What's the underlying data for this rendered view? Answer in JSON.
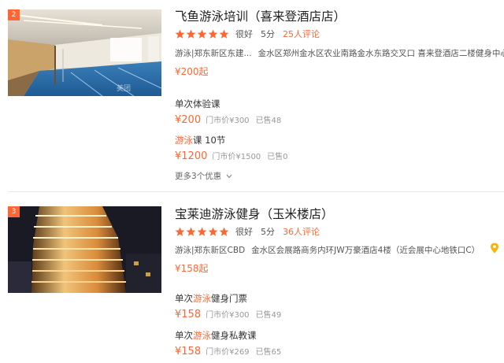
{
  "listings": [
    {
      "rank": "2",
      "title": "飞鱼游泳培训（喜来登酒店店）",
      "rating_word": "很好",
      "score": "5分",
      "reviews": "25人评论",
      "category": "游泳|郑东新区东建...",
      "address": "金水区郑州金水区农业南路金水东路交叉口 喜来登酒店二楼健身中心",
      "from_price": "¥200起",
      "watermark": "美团",
      "deals": [
        {
          "name_pre": "单次体验课",
          "name_hl": "",
          "name_post": "",
          "price": "¥200",
          "orig": "门市价¥300",
          "sold": "已售48"
        },
        {
          "name_pre": "",
          "name_hl": "游泳",
          "name_post": "课 10节",
          "price": "¥1200",
          "orig": "门市价¥1500",
          "sold": "已售0"
        }
      ],
      "more": "更多3个优惠"
    },
    {
      "rank": "3",
      "title": "宝莱迪游泳健身（玉米楼店）",
      "rating_word": "很好",
      "score": "5分",
      "reviews": "36人评论",
      "category": "游泳|郑东新区CBD",
      "address": "金水区会展路商务内环JW万豪酒店4楼（近会展中心地铁口C）",
      "from_price": "¥158起",
      "deals": [
        {
          "name_pre": "单次",
          "name_hl": "游泳",
          "name_post": "健身门票",
          "price": "¥158",
          "orig": "门市价¥300",
          "sold": "已售49"
        },
        {
          "name_pre": "单次",
          "name_hl": "游泳",
          "name_post": "健身私教课",
          "price": "¥158",
          "orig": "门市价¥269",
          "sold": "已售65"
        }
      ]
    }
  ],
  "colors": {
    "accent": "#ff6633",
    "pin": "#f5b800"
  },
  "icons": {
    "star": "star-icon",
    "chevron": "chevron-down-icon",
    "pin": "location-pin-icon"
  }
}
